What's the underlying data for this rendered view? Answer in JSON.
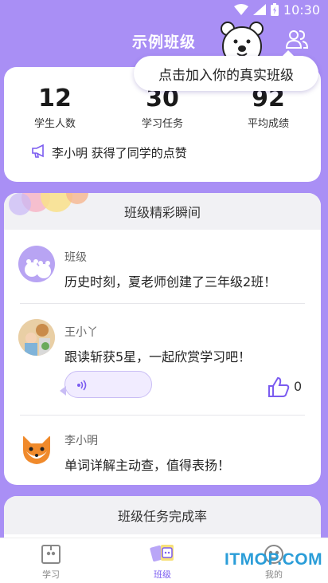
{
  "status_bar": {
    "time": "10:30"
  },
  "header": {
    "title": "示例班级"
  },
  "tooltip": {
    "text": "点击加入你的真实班级"
  },
  "stats": [
    {
      "value": "12",
      "label": "学生人数"
    },
    {
      "value": "30",
      "label": "学习任务"
    },
    {
      "value": "92",
      "label": "平均成绩"
    }
  ],
  "notice": {
    "text": "李小明 获得了同学的点赞"
  },
  "moments": {
    "title": "班级精彩瞬间",
    "items": [
      {
        "author": "班级",
        "message": "历史时刻，夏老师创建了三年级2班！",
        "avatar": "bear-avatar"
      },
      {
        "author": "王小丫",
        "message": "跟读斩获5星，一起欣赏学习吧！",
        "avatar": "child-photo-avatar",
        "likes": "0"
      },
      {
        "author": "李小明",
        "message": "单词详解主动查，值得表扬！",
        "avatar": "fox-avatar"
      }
    ]
  },
  "tasks": {
    "title": "班级任务完成率"
  },
  "nav": [
    {
      "label": "学习",
      "icon": "book-icon"
    },
    {
      "label": "班级",
      "icon": "class-icon",
      "active": true
    },
    {
      "label": "我的",
      "icon": "profile-icon"
    }
  ],
  "watermark": {
    "text": "ITMOP.COM"
  },
  "colors": {
    "brand": "#a98ff5",
    "accent": "#7b5cf0",
    "watermark": "#2a9dd8"
  }
}
